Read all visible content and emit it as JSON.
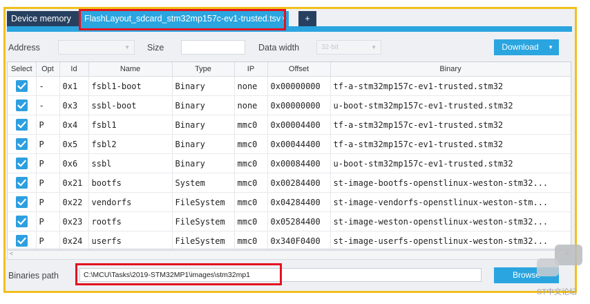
{
  "tabs": {
    "device_memory": "Device memory",
    "flash_layout": "FlashLayout_sdcard_stm32mp157c-ev1-trusted.tsv",
    "close": "×",
    "add": "+"
  },
  "toolbar": {
    "address_label": "Address",
    "size_label": "Size",
    "data_width_label": "Data width",
    "data_width_value": "32-bit",
    "download_label": "Download"
  },
  "table": {
    "headers": [
      "Select",
      "Opt",
      "Id",
      "Name",
      "Type",
      "IP",
      "Offset",
      "Binary"
    ],
    "rows": [
      {
        "opt": "-",
        "id": "0x1",
        "name": "fsbl1-boot",
        "type": "Binary",
        "ip": "none",
        "offset": "0x00000000",
        "binary": "tf-a-stm32mp157c-ev1-trusted.stm32"
      },
      {
        "opt": "-",
        "id": "0x3",
        "name": "ssbl-boot",
        "type": "Binary",
        "ip": "none",
        "offset": "0x00000000",
        "binary": "u-boot-stm32mp157c-ev1-trusted.stm32"
      },
      {
        "opt": "P",
        "id": "0x4",
        "name": "fsbl1",
        "type": "Binary",
        "ip": "mmc0",
        "offset": "0x00004400",
        "binary": "tf-a-stm32mp157c-ev1-trusted.stm32"
      },
      {
        "opt": "P",
        "id": "0x5",
        "name": "fsbl2",
        "type": "Binary",
        "ip": "mmc0",
        "offset": "0x00044400",
        "binary": "tf-a-stm32mp157c-ev1-trusted.stm32"
      },
      {
        "opt": "P",
        "id": "0x6",
        "name": "ssbl",
        "type": "Binary",
        "ip": "mmc0",
        "offset": "0x00084400",
        "binary": "u-boot-stm32mp157c-ev1-trusted.stm32"
      },
      {
        "opt": "P",
        "id": "0x21",
        "name": "bootfs",
        "type": "System",
        "ip": "mmc0",
        "offset": "0x00284400",
        "binary": "st-image-bootfs-openstlinux-weston-stm32..."
      },
      {
        "opt": "P",
        "id": "0x22",
        "name": "vendorfs",
        "type": "FileSystem",
        "ip": "mmc0",
        "offset": "0x04284400",
        "binary": "st-image-vendorfs-openstlinux-weston-stm..."
      },
      {
        "opt": "P",
        "id": "0x23",
        "name": "rootfs",
        "type": "FileSystem",
        "ip": "mmc0",
        "offset": "0x05284400",
        "binary": "st-image-weston-openstlinux-weston-stm32..."
      },
      {
        "opt": "P",
        "id": "0x24",
        "name": "userfs",
        "type": "FileSystem",
        "ip": "mmc0",
        "offset": "0x340F0400",
        "binary": "st-image-userfs-openstlinux-weston-stm32..."
      }
    ]
  },
  "scroll": {
    "left": "<",
    "right": ">"
  },
  "binaries": {
    "label": "Binaries path",
    "path": "C:\\MCU\\Tasks\\2019-STM32MP1\\images\\stm32mp1",
    "browse_label": "Browse"
  },
  "watermark": {
    "text": "ST中文论坛"
  },
  "colors": {
    "highlight": "#e3111f",
    "frame": "#f2bf1e",
    "accent": "#2aa5e0",
    "dark_tab": "#27405f"
  }
}
